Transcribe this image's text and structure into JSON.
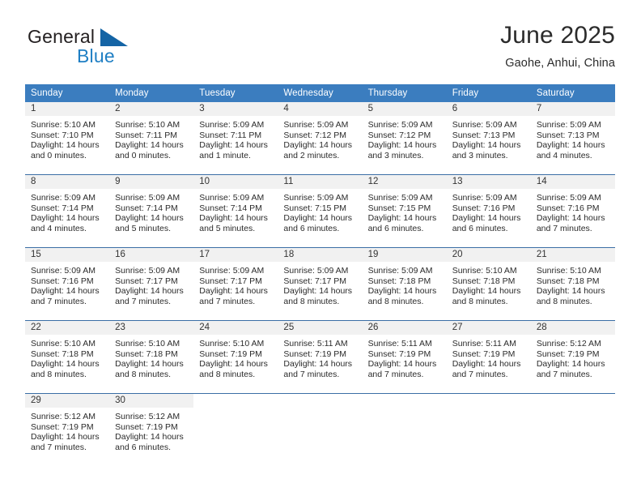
{
  "brand": {
    "name_top": "General",
    "name_bottom": "Blue",
    "accent_color": "#1f7fc4",
    "triangle_color": "#1464a5"
  },
  "header": {
    "title": "June 2025",
    "subtitle": "Gaohe, Anhui, China"
  },
  "theme": {
    "header_row_bg": "#3b7dbf",
    "header_row_text": "#ffffff",
    "daynum_band_bg": "#f1f1f1",
    "week_divider": "#3b6ea5"
  },
  "weekdays": [
    "Sunday",
    "Monday",
    "Tuesday",
    "Wednesday",
    "Thursday",
    "Friday",
    "Saturday"
  ],
  "weeks": [
    [
      {
        "day": "1",
        "sunrise": "Sunrise: 5:10 AM",
        "sunset": "Sunset: 7:10 PM",
        "daylight_1": "Daylight: 14 hours",
        "daylight_2": "and 0 minutes."
      },
      {
        "day": "2",
        "sunrise": "Sunrise: 5:10 AM",
        "sunset": "Sunset: 7:11 PM",
        "daylight_1": "Daylight: 14 hours",
        "daylight_2": "and 0 minutes."
      },
      {
        "day": "3",
        "sunrise": "Sunrise: 5:09 AM",
        "sunset": "Sunset: 7:11 PM",
        "daylight_1": "Daylight: 14 hours",
        "daylight_2": "and 1 minute."
      },
      {
        "day": "4",
        "sunrise": "Sunrise: 5:09 AM",
        "sunset": "Sunset: 7:12 PM",
        "daylight_1": "Daylight: 14 hours",
        "daylight_2": "and 2 minutes."
      },
      {
        "day": "5",
        "sunrise": "Sunrise: 5:09 AM",
        "sunset": "Sunset: 7:12 PM",
        "daylight_1": "Daylight: 14 hours",
        "daylight_2": "and 3 minutes."
      },
      {
        "day": "6",
        "sunrise": "Sunrise: 5:09 AM",
        "sunset": "Sunset: 7:13 PM",
        "daylight_1": "Daylight: 14 hours",
        "daylight_2": "and 3 minutes."
      },
      {
        "day": "7",
        "sunrise": "Sunrise: 5:09 AM",
        "sunset": "Sunset: 7:13 PM",
        "daylight_1": "Daylight: 14 hours",
        "daylight_2": "and 4 minutes."
      }
    ],
    [
      {
        "day": "8",
        "sunrise": "Sunrise: 5:09 AM",
        "sunset": "Sunset: 7:14 PM",
        "daylight_1": "Daylight: 14 hours",
        "daylight_2": "and 4 minutes."
      },
      {
        "day": "9",
        "sunrise": "Sunrise: 5:09 AM",
        "sunset": "Sunset: 7:14 PM",
        "daylight_1": "Daylight: 14 hours",
        "daylight_2": "and 5 minutes."
      },
      {
        "day": "10",
        "sunrise": "Sunrise: 5:09 AM",
        "sunset": "Sunset: 7:14 PM",
        "daylight_1": "Daylight: 14 hours",
        "daylight_2": "and 5 minutes."
      },
      {
        "day": "11",
        "sunrise": "Sunrise: 5:09 AM",
        "sunset": "Sunset: 7:15 PM",
        "daylight_1": "Daylight: 14 hours",
        "daylight_2": "and 6 minutes."
      },
      {
        "day": "12",
        "sunrise": "Sunrise: 5:09 AM",
        "sunset": "Sunset: 7:15 PM",
        "daylight_1": "Daylight: 14 hours",
        "daylight_2": "and 6 minutes."
      },
      {
        "day": "13",
        "sunrise": "Sunrise: 5:09 AM",
        "sunset": "Sunset: 7:16 PM",
        "daylight_1": "Daylight: 14 hours",
        "daylight_2": "and 6 minutes."
      },
      {
        "day": "14",
        "sunrise": "Sunrise: 5:09 AM",
        "sunset": "Sunset: 7:16 PM",
        "daylight_1": "Daylight: 14 hours",
        "daylight_2": "and 7 minutes."
      }
    ],
    [
      {
        "day": "15",
        "sunrise": "Sunrise: 5:09 AM",
        "sunset": "Sunset: 7:16 PM",
        "daylight_1": "Daylight: 14 hours",
        "daylight_2": "and 7 minutes."
      },
      {
        "day": "16",
        "sunrise": "Sunrise: 5:09 AM",
        "sunset": "Sunset: 7:17 PM",
        "daylight_1": "Daylight: 14 hours",
        "daylight_2": "and 7 minutes."
      },
      {
        "day": "17",
        "sunrise": "Sunrise: 5:09 AM",
        "sunset": "Sunset: 7:17 PM",
        "daylight_1": "Daylight: 14 hours",
        "daylight_2": "and 7 minutes."
      },
      {
        "day": "18",
        "sunrise": "Sunrise: 5:09 AM",
        "sunset": "Sunset: 7:17 PM",
        "daylight_1": "Daylight: 14 hours",
        "daylight_2": "and 8 minutes."
      },
      {
        "day": "19",
        "sunrise": "Sunrise: 5:09 AM",
        "sunset": "Sunset: 7:18 PM",
        "daylight_1": "Daylight: 14 hours",
        "daylight_2": "and 8 minutes."
      },
      {
        "day": "20",
        "sunrise": "Sunrise: 5:10 AM",
        "sunset": "Sunset: 7:18 PM",
        "daylight_1": "Daylight: 14 hours",
        "daylight_2": "and 8 minutes."
      },
      {
        "day": "21",
        "sunrise": "Sunrise: 5:10 AM",
        "sunset": "Sunset: 7:18 PM",
        "daylight_1": "Daylight: 14 hours",
        "daylight_2": "and 8 minutes."
      }
    ],
    [
      {
        "day": "22",
        "sunrise": "Sunrise: 5:10 AM",
        "sunset": "Sunset: 7:18 PM",
        "daylight_1": "Daylight: 14 hours",
        "daylight_2": "and 8 minutes."
      },
      {
        "day": "23",
        "sunrise": "Sunrise: 5:10 AM",
        "sunset": "Sunset: 7:18 PM",
        "daylight_1": "Daylight: 14 hours",
        "daylight_2": "and 8 minutes."
      },
      {
        "day": "24",
        "sunrise": "Sunrise: 5:10 AM",
        "sunset": "Sunset: 7:19 PM",
        "daylight_1": "Daylight: 14 hours",
        "daylight_2": "and 8 minutes."
      },
      {
        "day": "25",
        "sunrise": "Sunrise: 5:11 AM",
        "sunset": "Sunset: 7:19 PM",
        "daylight_1": "Daylight: 14 hours",
        "daylight_2": "and 7 minutes."
      },
      {
        "day": "26",
        "sunrise": "Sunrise: 5:11 AM",
        "sunset": "Sunset: 7:19 PM",
        "daylight_1": "Daylight: 14 hours",
        "daylight_2": "and 7 minutes."
      },
      {
        "day": "27",
        "sunrise": "Sunrise: 5:11 AM",
        "sunset": "Sunset: 7:19 PM",
        "daylight_1": "Daylight: 14 hours",
        "daylight_2": "and 7 minutes."
      },
      {
        "day": "28",
        "sunrise": "Sunrise: 5:12 AM",
        "sunset": "Sunset: 7:19 PM",
        "daylight_1": "Daylight: 14 hours",
        "daylight_2": "and 7 minutes."
      }
    ],
    [
      {
        "day": "29",
        "sunrise": "Sunrise: 5:12 AM",
        "sunset": "Sunset: 7:19 PM",
        "daylight_1": "Daylight: 14 hours",
        "daylight_2": "and 7 minutes."
      },
      {
        "day": "30",
        "sunrise": "Sunrise: 5:12 AM",
        "sunset": "Sunset: 7:19 PM",
        "daylight_1": "Daylight: 14 hours",
        "daylight_2": "and 6 minutes."
      },
      {
        "day": "",
        "sunrise": "",
        "sunset": "",
        "daylight_1": "",
        "daylight_2": ""
      },
      {
        "day": "",
        "sunrise": "",
        "sunset": "",
        "daylight_1": "",
        "daylight_2": ""
      },
      {
        "day": "",
        "sunrise": "",
        "sunset": "",
        "daylight_1": "",
        "daylight_2": ""
      },
      {
        "day": "",
        "sunrise": "",
        "sunset": "",
        "daylight_1": "",
        "daylight_2": ""
      },
      {
        "day": "",
        "sunrise": "",
        "sunset": "",
        "daylight_1": "",
        "daylight_2": ""
      }
    ]
  ]
}
